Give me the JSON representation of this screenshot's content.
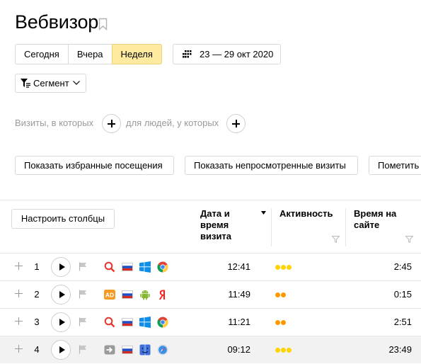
{
  "page": {
    "title": "Вебвизор"
  },
  "period": {
    "options": [
      "Сегодня",
      "Вчера",
      "Неделя"
    ],
    "selected": "Неделя",
    "date_range": "23 — 29 окт 2020"
  },
  "segment": {
    "label": "Сегмент"
  },
  "conditions": {
    "visits_label": "Визиты, в которых",
    "people_label": "для людей, у которых"
  },
  "actions": {
    "favorites": "Показать избранные посещения",
    "unviewed": "Показать непросмотренные визиты",
    "mark": "Пометить"
  },
  "table": {
    "configure_columns": "Настроить столбцы",
    "headers": {
      "datetime": "Дата и время визита",
      "activity": "Активность",
      "time_on_site": "Время на сайте"
    },
    "rows": [
      {
        "num": "1",
        "time": "12:41",
        "activity_level": 3,
        "activity_color": "#ffd400",
        "duration": "2:45",
        "icons": [
          "search-icon",
          "russia-flag-icon",
          "windows-icon",
          "chrome-icon"
        ]
      },
      {
        "num": "2",
        "time": "11:49",
        "activity_level": 2,
        "activity_color": "#ff9900",
        "duration": "0:15",
        "icons": [
          "ad-icon",
          "russia-flag-icon",
          "android-icon",
          "yandex-browser-icon"
        ]
      },
      {
        "num": "3",
        "time": "11:21",
        "activity_level": 2,
        "activity_color": "#ff9900",
        "duration": "2:51",
        "icons": [
          "search-icon",
          "russia-flag-icon",
          "windows-icon",
          "chrome-icon"
        ]
      },
      {
        "num": "4",
        "time": "09:12",
        "activity_level": 3,
        "activity_color": "#ffd400",
        "duration": "23:49",
        "icons": [
          "direct-entry-icon",
          "russia-flag-icon",
          "macos-icon",
          "safari-icon"
        ]
      }
    ]
  },
  "colors": {
    "accent_active": "#ffeba0",
    "search_red": "#e5362f",
    "ad_orange": "#f59a23",
    "windows_blue": "#0e8ee9",
    "android_green": "#85b832",
    "yandex_red": "#ff1a1a"
  }
}
